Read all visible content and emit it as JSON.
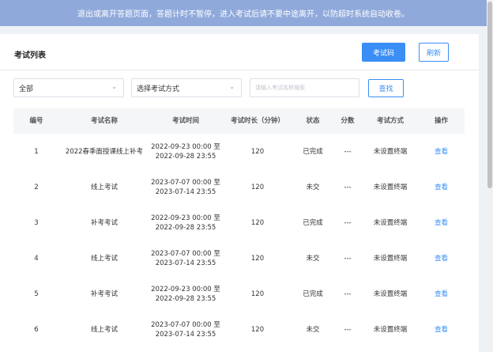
{
  "notice": "退出或离开答题页面，答题计时不暂停，进入考试后请不要中途离开，以防超时系统自动收卷。",
  "header": {
    "title": "考试列表",
    "exam_code_label": "考试码",
    "refresh_label": "刷新"
  },
  "filters": {
    "status_selected": "全部",
    "mode_selected": "选择考试方式",
    "search_placeholder": "请输入考试名称搜索",
    "search_label": "查找"
  },
  "table": {
    "columns": [
      "编号",
      "考试名称",
      "考试时间",
      "考试时长（分钟）",
      "状态",
      "分数",
      "考试方式",
      "操作"
    ],
    "rows": [
      {
        "id": "1",
        "name": "2022春季面授课线上补考",
        "time_start": "2022-09-23 00:00 至",
        "time_end": "2022-09-28 23:55",
        "duration": "120",
        "status": "已完成",
        "score": "---",
        "mode": "未设置终端",
        "action": "查看"
      },
      {
        "id": "2",
        "name": "线上考试",
        "time_start": "2023-07-07 00:00 至",
        "time_end": "2023-07-14 23:55",
        "duration": "120",
        "status": "未交",
        "score": "---",
        "mode": "未设置终端",
        "action": "查看"
      },
      {
        "id": "3",
        "name": "补考考试",
        "time_start": "2022-09-23 00:00 至",
        "time_end": "2022-09-28 23:55",
        "duration": "120",
        "status": "已完成",
        "score": "---",
        "mode": "未设置终端",
        "action": "查看"
      },
      {
        "id": "4",
        "name": "线上考试",
        "time_start": "2023-07-07 00:00 至",
        "time_end": "2023-07-14 23:55",
        "duration": "120",
        "status": "未交",
        "score": "---",
        "mode": "未设置终端",
        "action": "查看"
      },
      {
        "id": "5",
        "name": "补考考试",
        "time_start": "2022-09-23 00:00 至",
        "time_end": "2022-09-28 23:55",
        "duration": "120",
        "status": "已完成",
        "score": "---",
        "mode": "未设置终端",
        "action": "查看"
      },
      {
        "id": "6",
        "name": "线上考试",
        "time_start": "2023-07-07 00:00 至",
        "time_end": "2023-07-14 23:55",
        "duration": "120",
        "status": "未交",
        "score": "---",
        "mode": "未设置终端",
        "action": "查看"
      }
    ]
  },
  "colors": {
    "accent": "#3a8ef6",
    "notice_bg": "#8fa9db"
  }
}
